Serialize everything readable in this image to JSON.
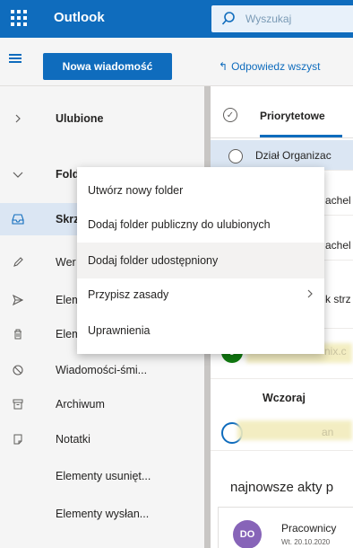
{
  "topbar": {
    "app_name": "Outlook",
    "search_placeholder": "Wyszukaj"
  },
  "commandbar": {
    "new_message_label": "Nowa wiadomość",
    "reply_all_label": "Odpowiedz wszyst"
  },
  "sidebar": {
    "items": [
      {
        "label": "Ulubione",
        "icon": "chevron-right-icon"
      },
      {
        "label": "Fold",
        "icon": "chevron-down-icon"
      },
      {
        "label": "Skrz",
        "icon": "inbox-icon"
      },
      {
        "label": "Wer",
        "icon": "pencil-icon"
      },
      {
        "label": "Elem",
        "icon": "send-icon"
      },
      {
        "label": "Elem",
        "icon": "trash-icon"
      },
      {
        "label": "Wiadomości-śmi...",
        "icon": "block-icon"
      },
      {
        "label": "Archiwum",
        "icon": "archive-icon"
      },
      {
        "label": "Notatki",
        "icon": "note-icon"
      },
      {
        "label": "Elementy usunięt...",
        "icon": ""
      },
      {
        "label": "Elementy wysłan...",
        "icon": ""
      }
    ]
  },
  "message_list": {
    "focused_tab": "Priorytetowe",
    "rows": [
      {
        "sender": "Dział Organizac",
        "preview": ""
      },
      {
        "sender": "",
        "preview": "achel"
      },
      {
        "sender": "",
        "preview": "achel"
      },
      {
        "sender": "",
        "preview": "k strz"
      }
    ],
    "avatar_initial": "J",
    "blurred_domain": "nix.c",
    "group_header": "Wczoraj",
    "blurred_name": "an",
    "promo_title": "najnowsze akty p",
    "card": {
      "avatar_initials": "DO",
      "sender": "Pracownicy",
      "date": "Wt. 20.10.2020"
    }
  },
  "context_menu": {
    "items": [
      {
        "label": "Utwórz nowy folder"
      },
      {
        "label": "Dodaj folder publiczny do ulubionych"
      },
      {
        "label": "Dodaj folder udostępniony"
      },
      {
        "label": "Przypisz zasady",
        "submenu_icon": "chevron-right-icon"
      },
      {
        "label": "Uprawnienia"
      }
    ]
  },
  "colors": {
    "brand": "#0f6cbd",
    "selected": "#dbe6f3",
    "avatar_j": "#107c10",
    "avatar_do": "#8764b8"
  }
}
